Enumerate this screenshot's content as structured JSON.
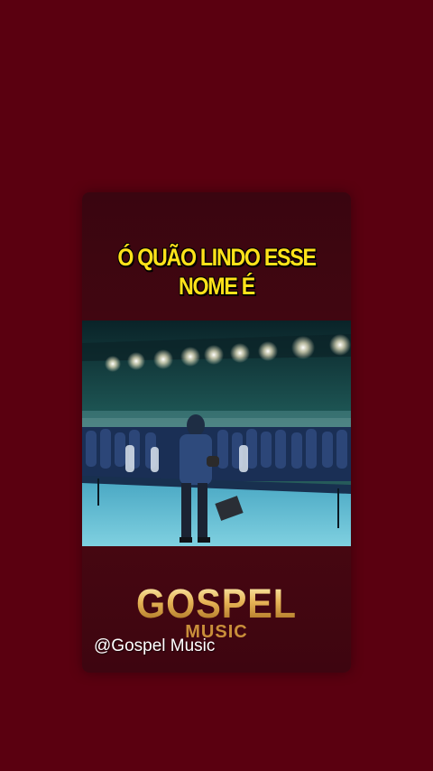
{
  "post": {
    "headline_line1": "Ó QUÃO LINDO ESSE",
    "headline_line2": "NOME É"
  },
  "brand": {
    "logo_main": "GOSPEL",
    "logo_sub": "MUSIC"
  },
  "watermark": {
    "handle": "@Gospel Music"
  },
  "colors": {
    "background": "#5a0010",
    "headline": "#ffe21a",
    "logo_gold": "#e6b457"
  }
}
